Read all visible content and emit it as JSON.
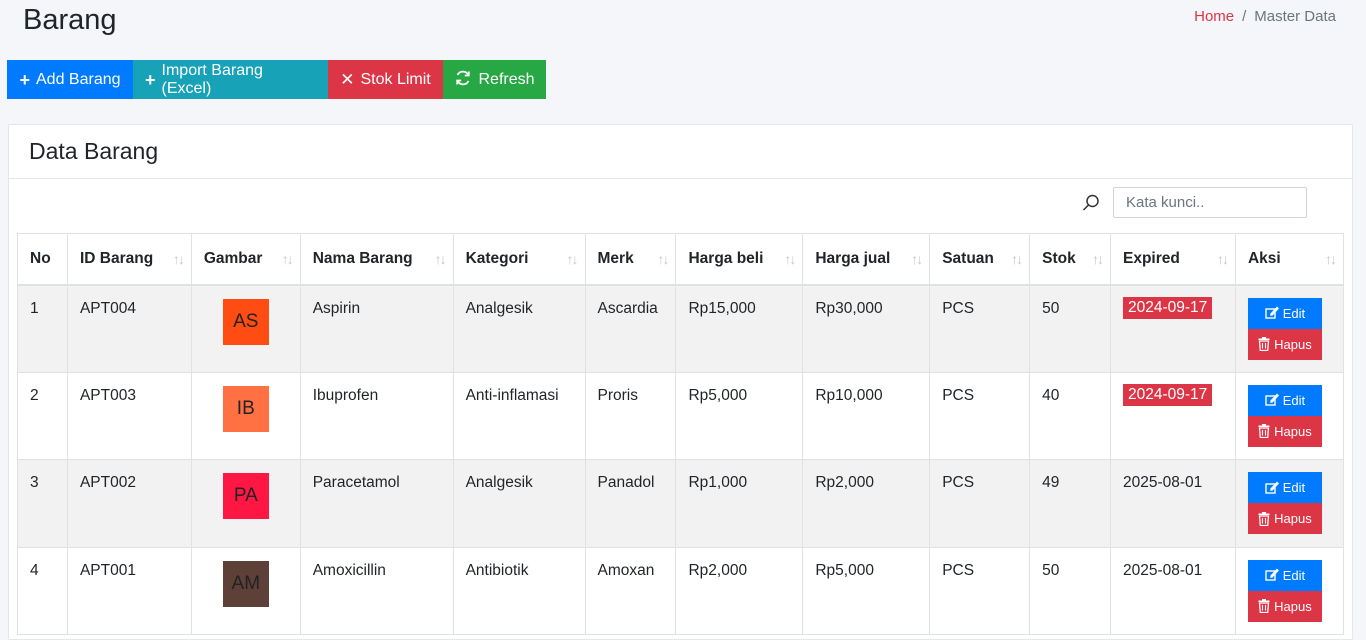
{
  "page": {
    "title": "Barang"
  },
  "breadcrumb": {
    "home": "Home",
    "separator": "/",
    "current": "Master Data"
  },
  "toolbar": {
    "add_label": "Add Barang",
    "import_label": "Import Barang (Excel)",
    "stok_label": "Stok Limit",
    "refresh_label": "Refresh"
  },
  "card": {
    "title": "Data Barang"
  },
  "search": {
    "placeholder": "Kata kunci.."
  },
  "table": {
    "headers": [
      "No",
      "ID Barang",
      "Gambar",
      "Nama Barang",
      "Kategori",
      "Merk",
      "Harga beli",
      "Harga jual",
      "Satuan",
      "Stok",
      "Expired",
      "Aksi"
    ],
    "rows": [
      {
        "no": "1",
        "id": "APT004",
        "img_text": "AS",
        "img_color": "#ff4c13",
        "nama": "Aspirin",
        "kategori": "Analgesik",
        "merk": "Ascardia",
        "beli": "Rp15,000",
        "jual": "Rp30,000",
        "satuan": "PCS",
        "stok": "50",
        "expired": "2024-09-17",
        "expired_badge": true
      },
      {
        "no": "2",
        "id": "APT003",
        "img_text": "IB",
        "img_color": "#ff7043",
        "nama": "Ibuprofen",
        "kategori": "Anti-inflamasi",
        "merk": "Proris",
        "beli": "Rp5,000",
        "jual": "Rp10,000",
        "satuan": "PCS",
        "stok": "40",
        "expired": "2024-09-17",
        "expired_badge": true
      },
      {
        "no": "3",
        "id": "APT002",
        "img_text": "PA",
        "img_color": "#ff1744",
        "nama": "Paracetamol",
        "kategori": "Analgesik",
        "merk": "Panadol",
        "beli": "Rp1,000",
        "jual": "Rp2,000",
        "satuan": "PCS",
        "stok": "49",
        "expired": "2025-08-01",
        "expired_badge": false
      },
      {
        "no": "4",
        "id": "APT001",
        "img_text": "AM",
        "img_color": "#5d4037",
        "nama": "Amoxicillin",
        "kategori": "Antibiotik",
        "merk": "Amoxan",
        "beli": "Rp2,000",
        "jual": "Rp5,000",
        "satuan": "PCS",
        "stok": "50",
        "expired": "2025-08-01",
        "expired_badge": false
      }
    ],
    "edit_label": "Edit",
    "delete_label": "Hapus"
  },
  "colors": {
    "primary": "#007bff",
    "info": "#17a2b8",
    "danger": "#dc3545",
    "success": "#28a745"
  },
  "icons": {
    "add": "plus-icon",
    "import": "plus-icon",
    "stok": "close-icon",
    "refresh": "refresh-icon",
    "search": "search-icon",
    "edit": "edit-icon",
    "delete": "trash-icon",
    "sort": "sort-icon"
  }
}
